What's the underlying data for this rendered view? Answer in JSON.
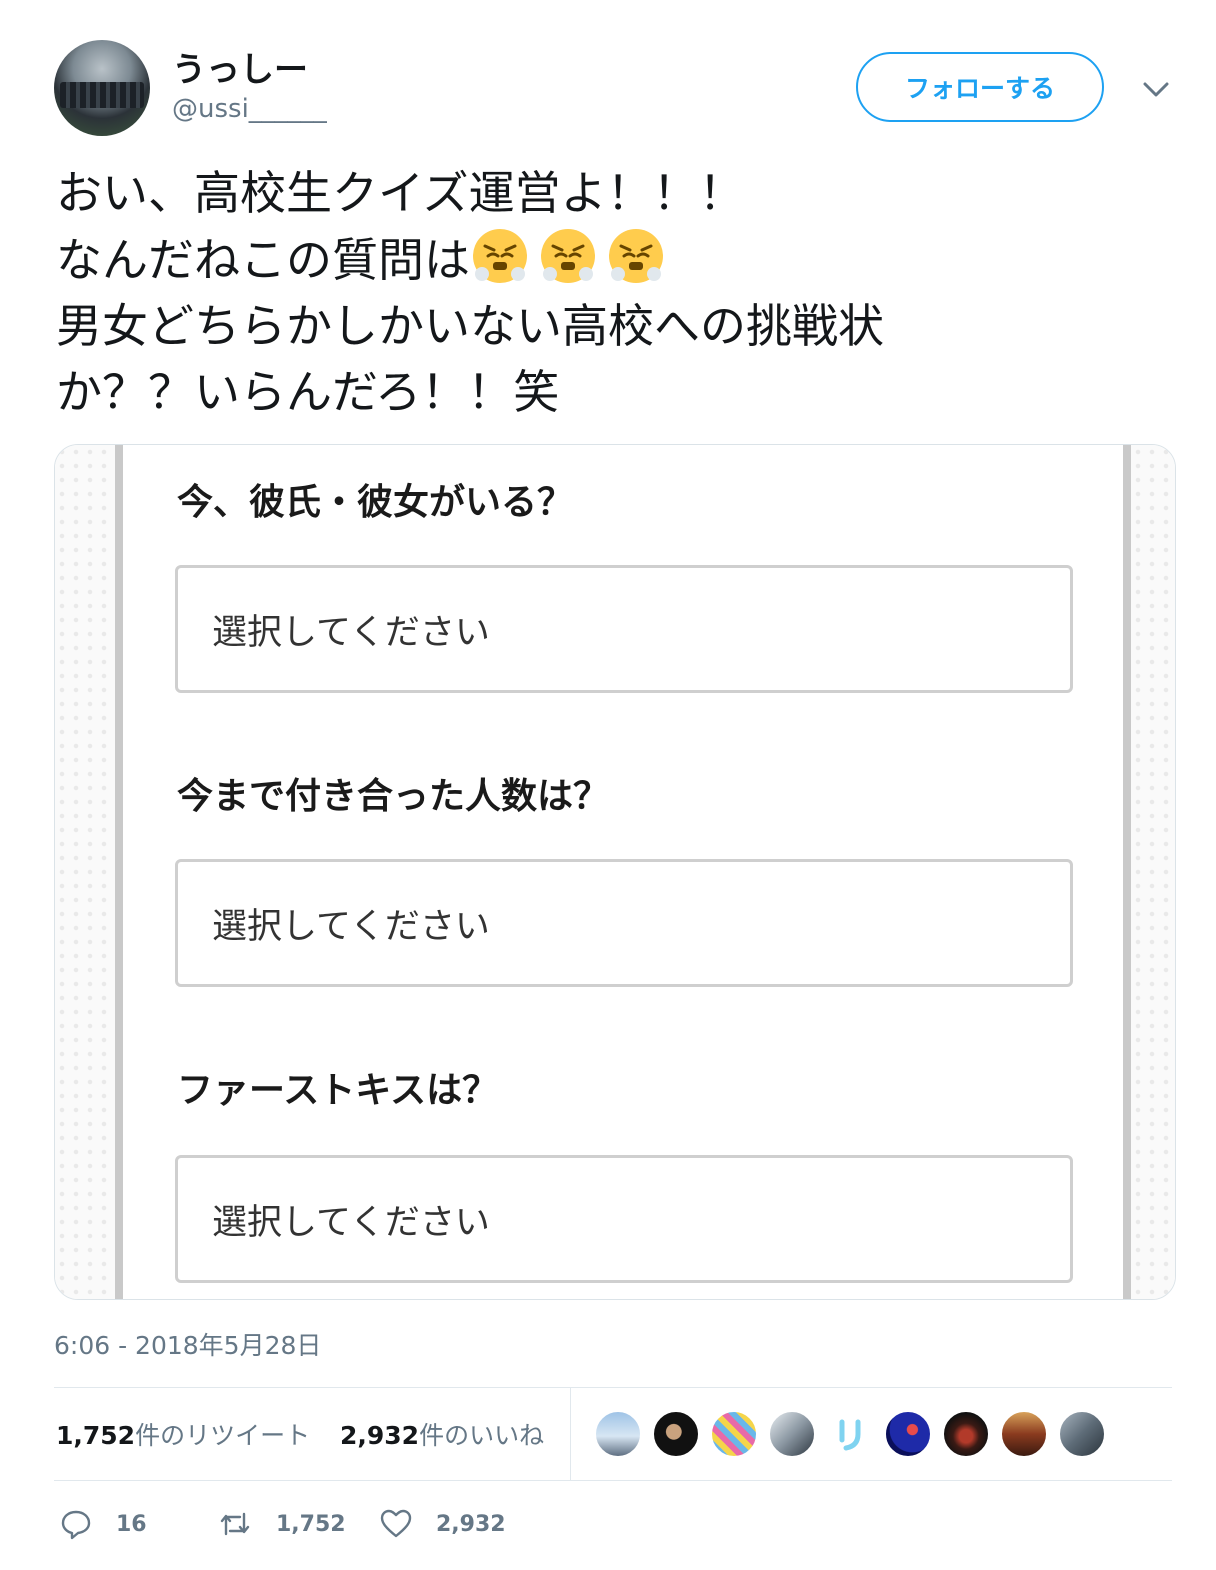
{
  "user": {
    "display_name": "うっしー",
    "screen_name": "@ussi______",
    "avatar_icon": "team-photo-avatar"
  },
  "follow_button": {
    "label": "フォローする",
    "color": "#1da1f2"
  },
  "menu_icon": "chevron-down-icon",
  "tweet": {
    "lines": [
      "おい、高校生クイズ運営よ！！！",
      "なんだねこの質問は",
      "男女どちらかしかいない高校への挑戦状",
      "か？？いらんだろ！！笑"
    ],
    "emoji": [
      "face-with-steam-icon",
      "face-with-steam-icon",
      "face-with-steam-icon"
    ]
  },
  "media": {
    "questions": [
      {
        "label": "今、彼氏・彼女がいる？",
        "select_value": "選択してください"
      },
      {
        "label": "今まで付き合った人数は？",
        "select_value": "選択してください"
      },
      {
        "label": "ファーストキスは？",
        "select_value": "選択してください"
      }
    ]
  },
  "timestamp": "6:06 - 2018年5月28日",
  "stats": {
    "retweets_count": "1,752",
    "retweets_label": "件のリツイート",
    "likes_count": "2,932",
    "likes_label": "件のいいね",
    "liker_avatars": 9
  },
  "actions": {
    "reply_count": "16",
    "retweet_count": "1,752",
    "like_count": "2,932"
  },
  "colors": {
    "accent": "#1da1f2",
    "secondary_text": "#657786",
    "border": "#e1e8ed"
  }
}
